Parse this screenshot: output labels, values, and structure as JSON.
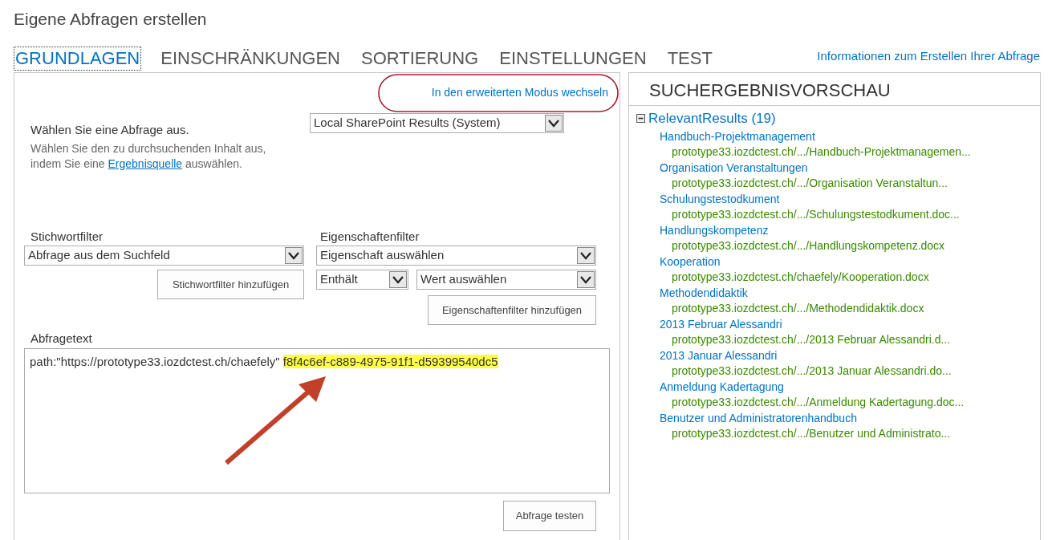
{
  "page_title": "Eigene Abfragen erstellen",
  "tabs": [
    {
      "label": "GRUNDLAGEN",
      "selected": true
    },
    {
      "label": "EINSCHRÄNKUNGEN",
      "selected": false
    },
    {
      "label": "SORTIERUNG",
      "selected": false
    },
    {
      "label": "EINSTELLUNGEN",
      "selected": false
    },
    {
      "label": "TEST",
      "selected": false
    }
  ],
  "help_link": "Informationen zum Erstellen Ihrer Abfrage",
  "advanced_mode_link": "In den erweiterten Modus wechseln",
  "query_select": {
    "label": "Wählen Sie eine Abfrage aus.",
    "description_before": "Wählen Sie den zu durchsuchenden Inhalt aus, indem Sie eine",
    "description_link": "Ergebnisquelle",
    "description_after": "auswählen.",
    "value": "Local SharePoint Results (System)"
  },
  "keyword_filter": {
    "label": "Stichwortfilter",
    "value": "Abfrage aus dem Suchfeld",
    "button": "Stichwortfilter hinzufügen"
  },
  "property_filter": {
    "label": "Eigenschaftenfilter",
    "property": "Eigenschaft auswählen",
    "operator": "Enthält",
    "value": "Wert auswählen",
    "button": "Eigenschaftenfilter hinzufügen"
  },
  "query_text": {
    "label": "Abfragetext",
    "value": "path:\"https://prototype33.iozdctest.ch/chaefely\"",
    "highlighted_value": "f8f4c6ef-c889-4975-91f1-d59399540dc5"
  },
  "test_button": "Abfrage testen",
  "preview": {
    "title": "SUCHERGEBNISVORSCHAU",
    "group": "RelevantResults (19)",
    "expanded": true,
    "results": [
      {
        "title": "Handbuch-Projektmanagement",
        "url": "prototype33.iozdctest.ch/.../Handbuch-Projektmanagemen..."
      },
      {
        "title": "Organisation Veranstaltungen",
        "url": "prototype33.iozdctest.ch/.../Organisation Veranstaltun..."
      },
      {
        "title": "Schulungstestodkument",
        "url": "prototype33.iozdctest.ch/.../Schulungstestodkument.doc..."
      },
      {
        "title": "Handlungskompetenz",
        "url": "prototype33.iozdctest.ch/.../Handlungskompetenz.docx"
      },
      {
        "title": "Kooperation",
        "url": "prototype33.iozdctest.ch/chaefely/Kooperation.docx"
      },
      {
        "title": "Methodendidaktik",
        "url": "prototype33.iozdctest.ch/.../Methodendidaktik.docx"
      },
      {
        "title": "2013 Februar Alessandri",
        "url": "prototype33.iozdctest.ch/.../2013 Februar Alessandri.d..."
      },
      {
        "title": "2013 Januar Alessandri",
        "url": "prototype33.iozdctest.ch/.../2013 Januar Alessandri.do..."
      },
      {
        "title": "Anmeldung Kadertagung",
        "url": "prototype33.iozdctest.ch/.../Anmeldung Kadertagung.doc..."
      },
      {
        "title": "Benutzer und Administratorenhandbuch",
        "url": "prototype33.iozdctest.ch/.../Benutzer und Administrato..."
      }
    ]
  }
}
